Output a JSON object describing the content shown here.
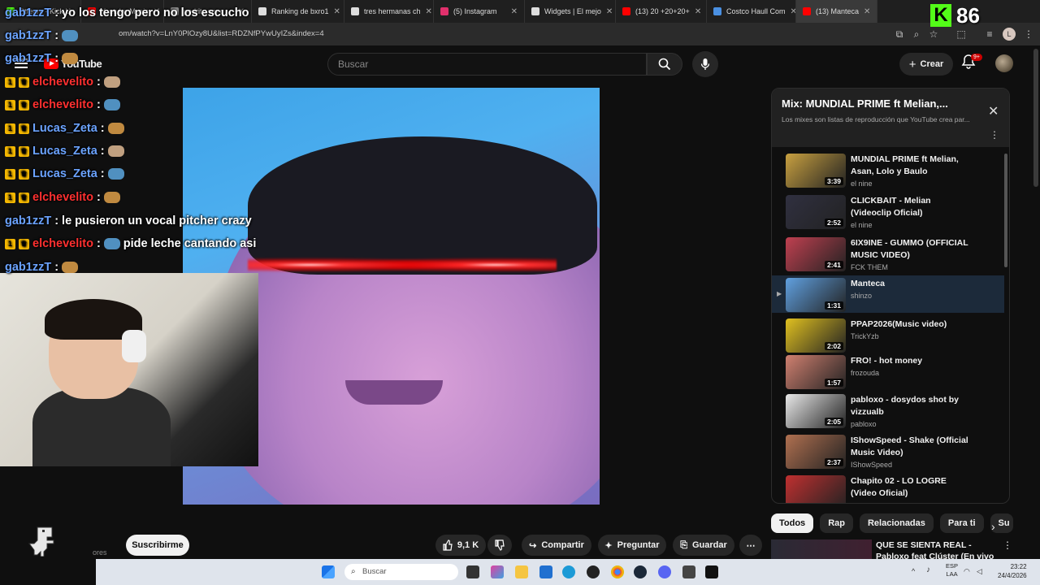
{
  "browser": {
    "tabs": [
      {
        "label": "Stream - Kick Un",
        "color": "#53fc18"
      },
      {
        "label": "Youtube Music",
        "color": "#ff0000"
      },
      {
        "label": "pedrito vm c",
        "color": "#888888"
      },
      {
        "label": "Ranking de bxro1",
        "color": "#dddddd"
      },
      {
        "label": "tres hermanas ch",
        "color": "#dddddd"
      },
      {
        "label": "(5) Instagram",
        "color": "#e1306c"
      },
      {
        "label": "Widgets | El mejo",
        "color": "#dddddd"
      },
      {
        "label": "(13) 20 +20+20+",
        "color": "#ff0000"
      },
      {
        "label": "Costco Haull Com",
        "color": "#4a90e2"
      },
      {
        "label": "(13) Manteca",
        "color": "#ff0000"
      }
    ],
    "url": "om/watch?v=LnY0PlOzy8U&list=RDZNfPYwUyIZs&index=4"
  },
  "kick": {
    "viewers": "86"
  },
  "youtube": {
    "logo": "YouTube",
    "search_placeholder": "Buscar",
    "create_label": "Crear",
    "notif_badge": "9+",
    "subscribe_label": "Suscribirme",
    "subscribers_fragment": "ores",
    "likes": "9,1 K",
    "share_label": "Compartir",
    "ask_label": "Preguntar",
    "save_label": "Guardar"
  },
  "chat": [
    {
      "user": "gab1zzT",
      "message": "yo los tengo pero no los escucho",
      "user_color": "#6ba3ff",
      "badges": false
    },
    {
      "user": "gab1zzT",
      "message": "",
      "user_color": "#6ba3ff",
      "badges": false
    },
    {
      "user": "gab1zzT",
      "message": "",
      "user_color": "#6ba3ff",
      "badges": false
    },
    {
      "user": "elchevelito",
      "message": "",
      "user_color": "#ff3030",
      "badges": true
    },
    {
      "user": "elchevelito",
      "message": "",
      "user_color": "#ff3030",
      "badges": true
    },
    {
      "user": "Lucas_Zeta",
      "message": "",
      "user_color": "#6ba3ff",
      "badges": true
    },
    {
      "user": "Lucas_Zeta",
      "message": "",
      "user_color": "#6ba3ff",
      "badges": true
    },
    {
      "user": "Lucas_Zeta",
      "message": "",
      "user_color": "#6ba3ff",
      "badges": true
    },
    {
      "user": "elchevelito",
      "message": "",
      "user_color": "#ff3030",
      "badges": true
    },
    {
      "user": "gab1zzT",
      "message": "le pusieron un vocal pitcher crazy",
      "user_color": "#6ba3ff",
      "badges": false
    },
    {
      "user": "elchevelito",
      "message": "pide leche cantando asi",
      "user_color": "#ff3030",
      "badges": true
    },
    {
      "user": "gab1zzT",
      "message": "",
      "user_color": "#6ba3ff",
      "badges": false
    }
  ],
  "playlist": {
    "title": "Mix: MUNDIAL PRIME ft Melian,...",
    "subtitle": "Los mixes son listas de reproducción que YouTube crea par...",
    "items": [
      {
        "title": "MUNDIAL PRIME ft Melian, Asan, Lolo y Baulo",
        "channel": "el nine",
        "duration": "3:39",
        "thumb": "#c8a040"
      },
      {
        "title": "CLICKBAIT - Melian (Videoclip Oficial)",
        "channel": "el nine",
        "duration": "2:52",
        "thumb": "#303040"
      },
      {
        "title": "6IX9INE - GUMMO (OFFICIAL MUSIC VIDEO)",
        "channel": "FCK THEM",
        "duration": "2:41",
        "thumb": "#c04050"
      },
      {
        "title": "Manteca",
        "channel": "shinzo",
        "duration": "1:31",
        "thumb": "#60a0e0"
      },
      {
        "title": "PPAP2026(Music video)",
        "channel": "TrickYzb",
        "duration": "2:02",
        "thumb": "#e0c020"
      },
      {
        "title": "FRO! - hot money",
        "channel": "frozouda",
        "duration": "1:57",
        "thumb": "#d08070"
      },
      {
        "title": "pabloxo - dosydos shot by vizzualb",
        "channel": "pabloxo",
        "duration": "2:05",
        "thumb": "#e8e8e8"
      },
      {
        "title": "IShowSpeed - Shake (Official Music Video)",
        "channel": "IShowSpeed",
        "duration": "2:37",
        "thumb": "#b07050"
      },
      {
        "title": "Chapito 02 - LO LOGRE (Video Oficial)",
        "channel": "",
        "duration": "",
        "thumb": "#c03030"
      }
    ]
  },
  "chips": [
    "Todos",
    "Rap",
    "Relacionadas",
    "Para ti",
    "Su"
  ],
  "next_video": {
    "title": "QUE SE SIENTA REAL - Pabloxo feat Clúster (En vivo - Uniclub)"
  },
  "taskbar": {
    "search_placeholder": "Buscar",
    "lang": "ESP",
    "lang2": "LAA",
    "time": "23:22",
    "date": "24/4/2026"
  }
}
